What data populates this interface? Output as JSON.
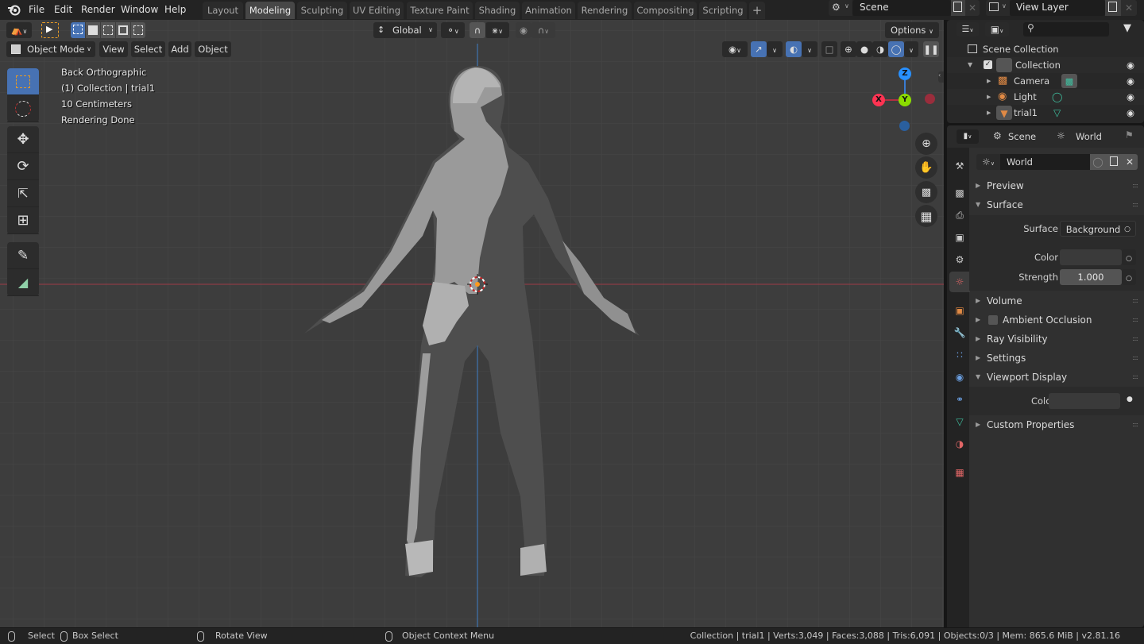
{
  "topbar": {
    "menus": [
      "File",
      "Edit",
      "Render",
      "Window",
      "Help"
    ],
    "workspaces": [
      "Layout",
      "Modeling",
      "Sculpting",
      "UV Editing",
      "Texture Paint",
      "Shading",
      "Animation",
      "Rendering",
      "Compositing",
      "Scripting"
    ],
    "active_workspace": "Modeling",
    "add_workspace": "+",
    "scene_name": "Scene",
    "view_layer_name": "View Layer"
  },
  "viewport": {
    "mode": "Object Mode",
    "menus": [
      "View",
      "Select",
      "Add",
      "Object"
    ],
    "transform_orientation": "Global",
    "options_label": "Options",
    "overlay_info": [
      "Back Orthographic",
      "(1) Collection | trial1",
      "10 Centimeters",
      "Rendering Done"
    ],
    "gizmo_axes": {
      "x": "X",
      "y": "Y",
      "z": "Z"
    },
    "colors": {
      "x_axis": "#ff3352",
      "y_axis": "#8bdc00",
      "z_axis": "#2890ff",
      "active_blue": "#4772b3"
    }
  },
  "outliner": {
    "search_placeholder": "",
    "root": "Scene Collection",
    "items": [
      {
        "name": "Collection",
        "level": 1
      },
      {
        "name": "Camera",
        "level": 2
      },
      {
        "name": "Light",
        "level": 2
      },
      {
        "name": "trial1",
        "level": 2
      }
    ]
  },
  "properties": {
    "breadcrumb": [
      "Scene",
      "World"
    ],
    "datablock_name": "World",
    "panels": [
      {
        "label": "Preview",
        "open": false
      },
      {
        "label": "Surface",
        "open": true
      },
      {
        "label": "Volume",
        "open": false
      },
      {
        "label": "Ambient Occlusion",
        "open": false,
        "checkbox": false
      },
      {
        "label": "Ray Visibility",
        "open": false
      },
      {
        "label": "Settings",
        "open": false
      },
      {
        "label": "Viewport Display",
        "open": true
      },
      {
        "label": "Custom Properties",
        "open": false
      }
    ],
    "surface": {
      "surface_label": "Surface",
      "surface_value": "Background",
      "color_label": "Color",
      "strength_label": "Strength",
      "strength_value": "1.000"
    },
    "viewport_display": {
      "color_label": "Color"
    }
  },
  "statusbar": {
    "select": "Select",
    "box_select": "Box Select",
    "rotate_view": "Rotate View",
    "context_menu": "Object Context Menu",
    "stats": "Collection | trial1 | Verts:3,049 | Faces:3,088 | Tris:6,091 | Objects:0/3 | Mem: 865.6 MiB | v2.81.16"
  }
}
